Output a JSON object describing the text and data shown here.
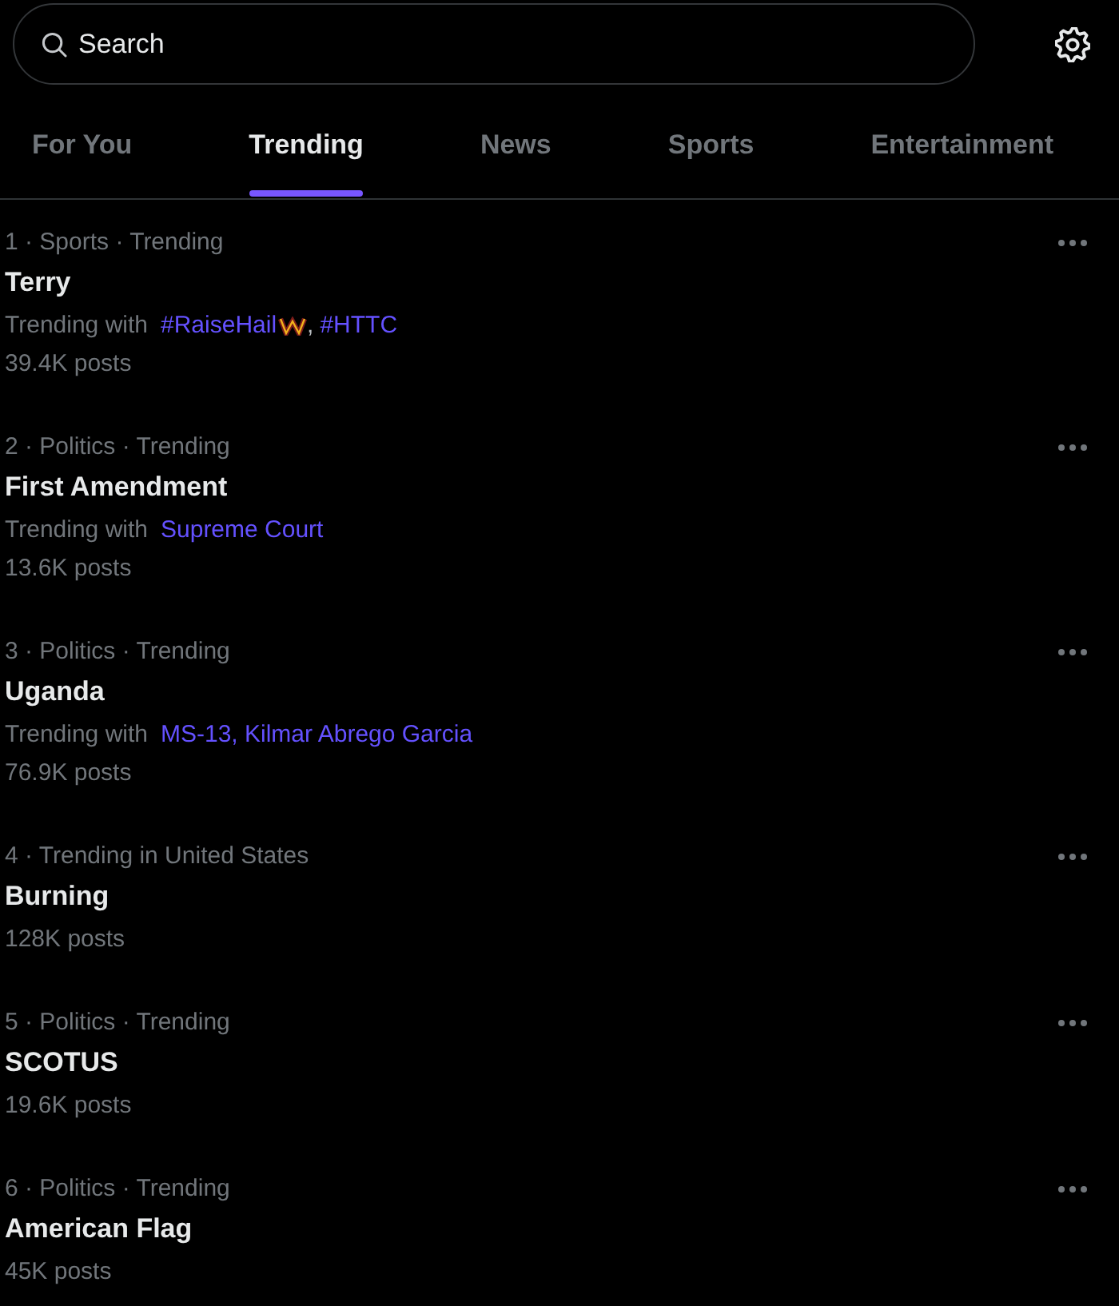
{
  "search": {
    "placeholder": "Search"
  },
  "tabs": [
    {
      "label": "For You",
      "selected": false
    },
    {
      "label": "Trending",
      "selected": true
    },
    {
      "label": "News",
      "selected": false
    },
    {
      "label": "Sports",
      "selected": false
    },
    {
      "label": "Entertainment",
      "selected": false
    }
  ],
  "trends": [
    {
      "context": "1 · Sports · Trending",
      "title": "Terry",
      "related": {
        "label": "Trending with",
        "items": [
          {
            "kind": "link",
            "text": "#RaiseHail",
            "emblem": true
          },
          {
            "kind": "plain",
            "text": ",",
            "emblem": false
          },
          {
            "kind": "link",
            "text": "#HTTC",
            "emblem": false
          }
        ]
      },
      "count": "39.4K posts"
    },
    {
      "context": "2 · Politics · Trending",
      "title": "First Amendment",
      "related": {
        "label": "Trending with",
        "items": [
          {
            "kind": "link",
            "text": "Supreme Court",
            "emblem": false
          }
        ]
      },
      "count": "13.6K posts"
    },
    {
      "context": "3 · Politics · Trending",
      "title": "Uganda",
      "related": {
        "label": "Trending with",
        "items": [
          {
            "kind": "link",
            "text": "MS-13, Kilmar Abrego Garcia",
            "emblem": false
          }
        ]
      },
      "count": "76.9K posts"
    },
    {
      "context": "4 · Trending in United States",
      "title": "Burning",
      "count": "128K posts"
    },
    {
      "context": "5 · Politics · Trending",
      "title": "SCOTUS",
      "count": "19.6K posts"
    },
    {
      "context": "6 · Politics · Trending",
      "title": "American Flag",
      "count": "45K posts"
    }
  ]
}
